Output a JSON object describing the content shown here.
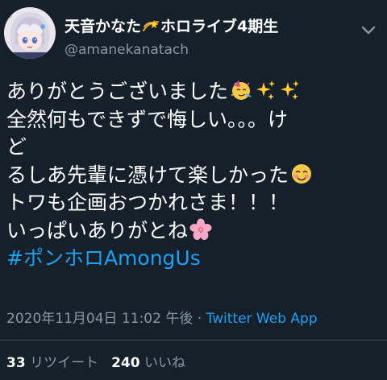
{
  "account": {
    "name_before": "天音かなた",
    "name_after": "ホロライブ4期生",
    "handle": "@amanekanatach"
  },
  "tweet": {
    "lines": [
      "ありがとうございました",
      "全然何もできずで悔しい。。。け",
      "ど",
      "るしあ先輩に憑けて楽しかった",
      "トワも企画おつかれさま！！！",
      "いっぱいありがとね"
    ],
    "hashtag": "#ポンホロAmongUs"
  },
  "meta": {
    "timestamp": "2020年11月04日 11:02 午後",
    "separator": " · ",
    "source": "Twitter Web App"
  },
  "stats": {
    "retweets_count": "33",
    "retweets_label": "リツイート",
    "likes_count": "240",
    "likes_label": "いいね"
  },
  "icons": {
    "avatar": "anime-girl-avatar",
    "name_sticker": "dizzy-star-icon",
    "menu": "chevron-down-icon",
    "emoji_line1": [
      "partying-face-icon",
      "sparkles-icon",
      "sparkles-icon"
    ],
    "emoji_line4": "smiling-face-icon",
    "emoji_line6": "cherry-blossom-icon"
  },
  "colors": {
    "background": "#15202b",
    "link": "#1da1f2",
    "secondary_text": "#8899a6"
  }
}
